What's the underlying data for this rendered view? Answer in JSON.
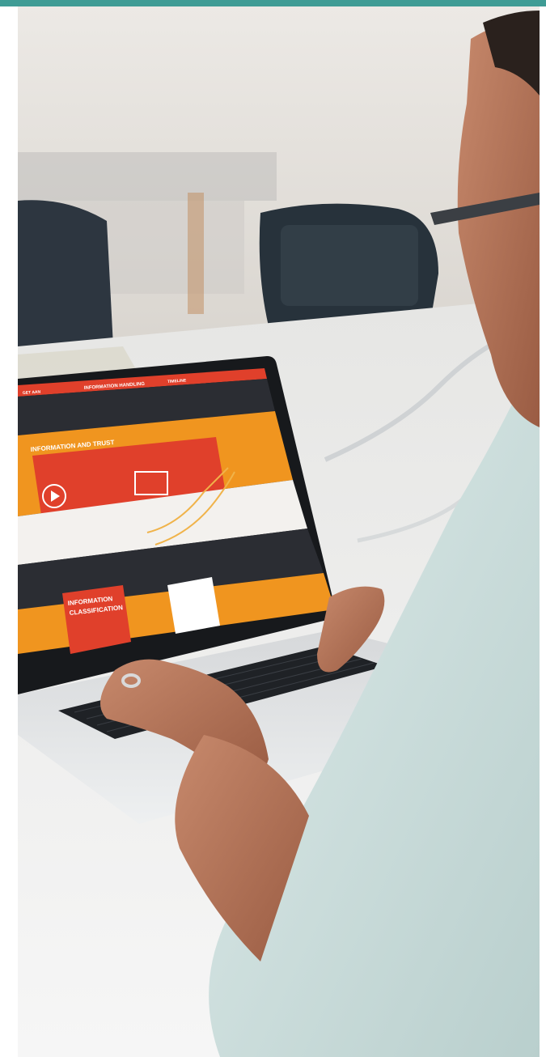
{
  "screen": {
    "header_left": "GET AAN",
    "header_title": "INFORMATION HANDLING",
    "header_right": "TIMELINE",
    "section1_title": "INFORMATION AND TRUST",
    "section2_title_line1": "INFORMATION",
    "section2_title_line2": "CLASSIFICATION"
  },
  "colors": {
    "accent_teal": "#3f9c95",
    "screen_red": "#e0402b",
    "screen_orange": "#f0951f",
    "screen_dark": "#2b2d33"
  }
}
